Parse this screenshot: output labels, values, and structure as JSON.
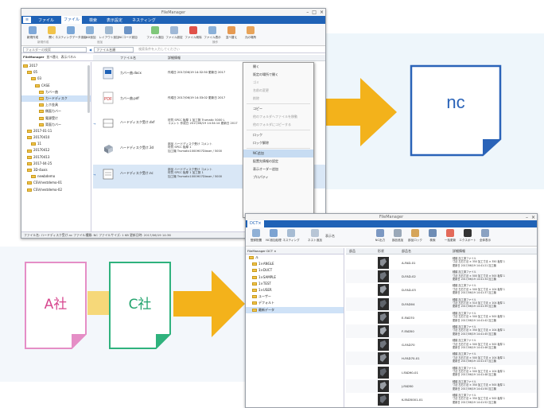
{
  "colors": {
    "accent": "#1f62b6",
    "arrow": "#f3b21b",
    "nc_border": "#2a63b8",
    "a_border": "#e58ec6",
    "c_border": "#2fb27d",
    "a_text": "#d7478f",
    "c_text": "#22a36d"
  },
  "fm1": {
    "title": "FileManager",
    "controls": [
      "–",
      "□",
      "×"
    ],
    "menus": [
      "ファイル",
      "ファイル",
      "検索",
      "表示設定",
      "ネスティング"
    ],
    "ribbon_buttons": [
      "新規作成",
      "開く",
      "ネスティングデータ追加",
      "CAD追加",
      "レイアウト追加",
      "NCコード追加",
      "ファイル追加",
      "ファイル設定",
      "ファイル削除",
      "ファイル表示",
      "並べ替え",
      "元の場所"
    ],
    "ribbon_groups": [
      "新規作成",
      "追加",
      "操作"
    ],
    "address_label": "フォルダーの検索",
    "address_path": "ファイル名順",
    "search_placeholder": "検索条件を入力してください",
    "tree_tabs": [
      "FileManager",
      "並べ替え",
      "表示パネル"
    ],
    "tree": [
      "2017",
      "05",
      "03",
      "CASE",
      "カバー曲",
      "カードディスク",
      "上ホ金具",
      "側面カバー",
      "電源受け",
      "背面カバー",
      "2017-01-11",
      "20170410",
      "11",
      "20170412",
      "20170413",
      "2017-04-25",
      "3D-4axis",
      "newbdemo",
      "CSV/nestdemo-01",
      "CSV/nestdemo-02"
    ],
    "list_headers": [
      "ファイル名",
      "詳細情報"
    ],
    "rows": [
      {
        "name": "カバー曲.docx",
        "detail": "作成日 2017/06/19 14:32:50 更新日 2017"
      },
      {
        "name": "カバー曲.pdf",
        "detail": "作成日 2017/06/19 14:33:02 更新日 2017"
      },
      {
        "name": "ハードディスク受け.dxf",
        "detail": "材質 SPCC 板厚 1 加工数 Trumatic 5000 L\nコメント 作成日 2017/06/19 14:34:14 更新日 2017"
      },
      {
        "name": "ハードディスク受け.3d",
        "detail": "部品 ハードディスク受け コメント\n材質 SPCC 板厚 1\n加工機 Trumatic1000H07Dlaser / 5000"
      },
      {
        "name": "ハードディスク受け.nc",
        "detail": "部品 ハードディスク受け コメント\n材質 SPCC 板厚 1 加工数 1\n加工機 Trumatic1000H07Dlaser / 5000"
      }
    ],
    "context_menu": [
      "開く",
      "既定の場所で開く",
      "ゴミ",
      "名前の変更",
      "削除",
      "コピー",
      "他のフォルダへファイルを移動",
      "他のフォルダにコピーする",
      "ロック",
      "ロック解除",
      "NC追加",
      "配置先情報の設定",
      "表示オーダー追加",
      "プロパティ"
    ],
    "status": "ファイル名: ハードディスク受け.nc  ファイル種類: NC  ファイルサイズ: 1 KB  更新日時: 2017/06/19 14:36"
  },
  "nc_label": "nc",
  "company_a": "A社",
  "company_c": "C社",
  "fm2": {
    "title": "FileManager",
    "tab": "DCT×",
    "ribbon_buttons": [
      "登録配置",
      "NC追加処理",
      "ネスティング",
      "ネスト追加",
      "NC出力",
      "部品追加",
      "部品ロック",
      "検索",
      "一括更新",
      "エクスポート",
      "全体表示"
    ],
    "search_label": "表示名",
    "tree_header": "FileManager  DCT ×",
    "tree": [
      "ル",
      "1×ANGLE",
      "1×DUCT",
      "1×SAMPLE",
      "1×TEST",
      "1×USER",
      "ユーザー",
      "デフォルト",
      "最新データ"
    ],
    "list_headers": [
      "部品",
      "形状",
      "部品名",
      "詳細情報"
    ],
    "rows": [
      {
        "part": "A-FAD-01",
        "info": "種類 加工済ファイル\n寸法 左右寸法 × 350 加工寸法 × 350 板厚 1\n更新日 2017/06/19 14:41:21 加工機"
      },
      {
        "part": "D-FAD-02",
        "info": "種類 加工済ファイル\n寸法 左右寸法 × 500 加工寸法 × 500 板厚 1\n更新日 2017/06/19 14:41:34 加工機"
      },
      {
        "part": "D-FAD-03",
        "info": "種類 加工済ファイル\n寸法 左右寸法 × 500 加工寸法 × 104 板厚 1\n更新日 2017/06/19 14:41:37 加工機"
      },
      {
        "part": "D-FAD04",
        "info": "種類 加工済ファイル\n寸法 左右寸法 × 510 加工寸法 × 104 板厚 1\n更新日 2017/06/19 14:41:39 加工機"
      },
      {
        "part": "E-FAD70",
        "info": "種類 加工済ファイル\n寸法 左右寸法 × 500 加工寸法 × 500 板厚 1\n更新日 2017/06/19 14:41:42 加工機"
      },
      {
        "part": "F-FAD50",
        "info": "種類 加工済ファイル\n寸法 左右寸法 × 350 加工寸法 × 104 板厚 1\n更新日 2017/06/19 14:41:45 加工機"
      },
      {
        "part": "G-FAD70",
        "info": "種類 加工済ファイル\n寸法 左右寸法 × 500 加工寸法 × 500 板厚 1\n更新日 2017/06/19 14:41:46 加工機"
      },
      {
        "part": "H-FAD70-01",
        "info": "種類 加工済ファイル\n寸法 左右寸法 × 500 加工寸法 × 104 板厚 1\n更新日 2017/06/19 14:41:47 加工機"
      },
      {
        "part": "I-FAD90-01",
        "info": "種類 加工済ファイル\n寸法 左右寸法 × 500 加工寸法 × 104 板厚 1\n更新日 2017/06/19 14:41:48 加工機"
      },
      {
        "part": "J-FAD50",
        "info": "種類 加工済ファイル\n寸法 左右寸法 × 350 加工寸法 × 500 板厚 1\n更新日 2017/06/19 14:41:50 加工機"
      },
      {
        "part": "K-FAD5001-01",
        "info": "種類 加工済ファイル\n寸法 左右寸法 × 350 加工寸法 × 500 板厚 1\n更新日 2017/06/19 14:41:52 加工機"
      }
    ]
  }
}
